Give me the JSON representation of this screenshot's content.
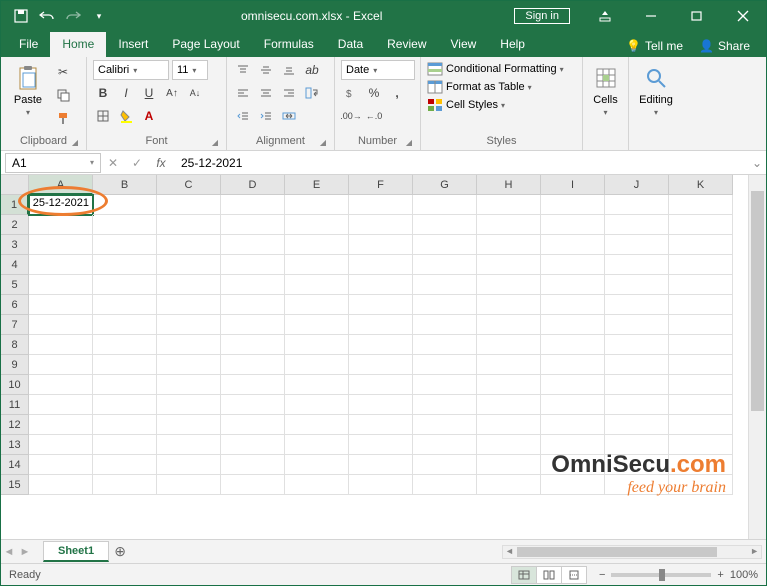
{
  "titlebar": {
    "title": "omnisecu.com.xlsx - Excel",
    "signin": "Sign in"
  },
  "tabs": {
    "file": "File",
    "list": [
      "Home",
      "Insert",
      "Page Layout",
      "Formulas",
      "Data",
      "Review",
      "View",
      "Help"
    ],
    "active": "Home",
    "tellme": "Tell me",
    "share": "Share"
  },
  "ribbon": {
    "clipboard": {
      "paste": "Paste",
      "label": "Clipboard"
    },
    "font": {
      "name": "Calibri",
      "size": "11",
      "label": "Font"
    },
    "alignment": {
      "label": "Alignment"
    },
    "number": {
      "format": "Date",
      "label": "Number"
    },
    "styles": {
      "cond": "Conditional Formatting",
      "table": "Format as Table",
      "cell": "Cell Styles",
      "label": "Styles"
    },
    "cells": {
      "label": "Cells"
    },
    "editing": {
      "label": "Editing"
    }
  },
  "formula_bar": {
    "namebox": "A1",
    "value": "25-12-2021"
  },
  "grid": {
    "columns": [
      "A",
      "B",
      "C",
      "D",
      "E",
      "F",
      "G",
      "H",
      "I",
      "J",
      "K"
    ],
    "rows": [
      1,
      2,
      3,
      4,
      5,
      6,
      7,
      8,
      9,
      10,
      11,
      12,
      13,
      14,
      15
    ],
    "selected": "A1",
    "cell_a1": "25-12-2021"
  },
  "sheets": {
    "active": "Sheet1"
  },
  "status": {
    "ready": "Ready",
    "zoom": "100%"
  },
  "watermark": {
    "brand_a": "OmniSecu",
    "brand_b": ".com",
    "tag": "feed your brain"
  }
}
